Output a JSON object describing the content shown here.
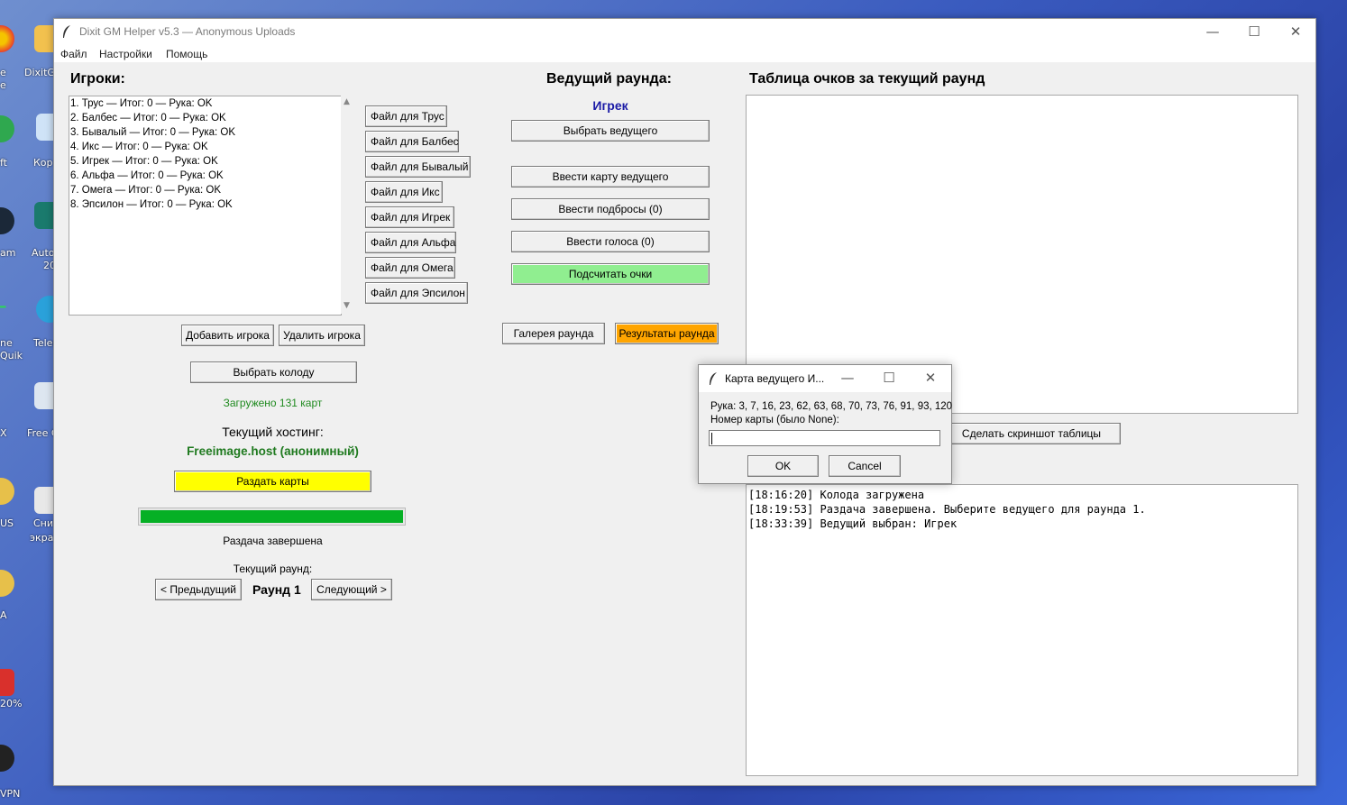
{
  "desktop": {
    "icons": [
      {
        "label": "e"
      },
      {
        "label": "e"
      },
      {
        "label": "DixitG"
      },
      {
        "label": "ft"
      },
      {
        "label": "Кор"
      },
      {
        "label": "am"
      },
      {
        "label": "Auto"
      },
      {
        "label": "20"
      },
      {
        "label": "ne"
      },
      {
        "label": "Quik"
      },
      {
        "label": "Teleg"
      },
      {
        "label": "X"
      },
      {
        "label": "Free C"
      },
      {
        "label": "US"
      },
      {
        "label": "Сни"
      },
      {
        "label": "экра"
      },
      {
        "label": "A"
      },
      {
        "label": "20%"
      },
      {
        "label": "VPN"
      }
    ]
  },
  "window": {
    "title": "Dixit GM Helper v5.3 — Anonymous Uploads",
    "controls": {
      "minimize": "—",
      "maximize": "☐",
      "close": "✕"
    }
  },
  "menu": [
    "Файл",
    "Настройки",
    "Помощь"
  ],
  "players": {
    "heading": "Игроки:",
    "list": [
      "1. Трус — Итог: 0 — Рука: OK",
      "2. Балбес — Итог: 0 — Рука: OK",
      "3. Бывалый — Итог: 0 — Рука: OK",
      "4. Икс — Итог: 0 — Рука: OK",
      "5. Игрек — Итог: 0 — Рука: OK",
      "6. Альфа — Итог: 0 — Рука: OK",
      "7. Омега — Итог: 0 — Рука: OK",
      "8. Эпсилон — Итог: 0 — Рука: OK"
    ],
    "file_buttons": [
      "Файл для Трус",
      "Файл для Балбес",
      "Файл для Бывалый",
      "Файл для Икс",
      "Файл для Игрек",
      "Файл для Альфа",
      "Файл для Омега",
      "Файл для Эпсилон"
    ],
    "add_label": "Добавить игрока",
    "remove_label": "Удалить игрока"
  },
  "deck": {
    "choose_label": "Выбрать колоду",
    "loaded_text": "Загружено 131 карт",
    "loaded_color": "#1f8a1f"
  },
  "hosting": {
    "label": "Текущий хостинг:",
    "value": "Freeimage.host (анонимный)",
    "value_color": "#1f7a1f"
  },
  "deal": {
    "button_label": "Раздать карты",
    "progress": 1.0,
    "status": "Раздача завершена"
  },
  "round": {
    "label": "Текущий раунд:",
    "prev_label": "< Предыдущий",
    "value": "Раунд 1",
    "next_label": "Следующий >"
  },
  "leader": {
    "heading": "Ведущий раунда:",
    "name": "Игрек",
    "name_color": "#1a1aa6",
    "choose_label": "Выбрать ведущего",
    "enter_card_label": "Ввести карту ведущего",
    "enter_throws_label": "Ввести подбросы (0)",
    "enter_votes_label": "Ввести голоса (0)",
    "count_label": "Подсчитать очки",
    "gallery_label": "Галерея раунда",
    "results_label": "Результаты раунда"
  },
  "scores": {
    "heading": "Таблица очков за текущий раунд",
    "screenshot_label": "Сделать скриншот таблицы"
  },
  "log": [
    "[18:16:20] Колода загружена",
    "[18:19:53] Раздача завершена. Выберите ведущего для раунда 1.",
    "[18:33:39] Ведущий выбран: Игрек"
  ],
  "dialog": {
    "title": "Карта ведущего И...",
    "hand": "Рука: 3, 7, 16, 23, 62, 63, 68, 70, 73, 76, 91, 93, 120",
    "prompt": "Номер карты (было None):",
    "value": "",
    "ok_label": "OK",
    "cancel_label": "Cancel",
    "controls": {
      "minimize": "—",
      "maximize": "☐",
      "close": "✕"
    }
  },
  "colors": {
    "count_button": "#90ee90",
    "results_button": "#ffa500",
    "deal_button": "#ffff00",
    "progress_fill": "#06b025"
  }
}
